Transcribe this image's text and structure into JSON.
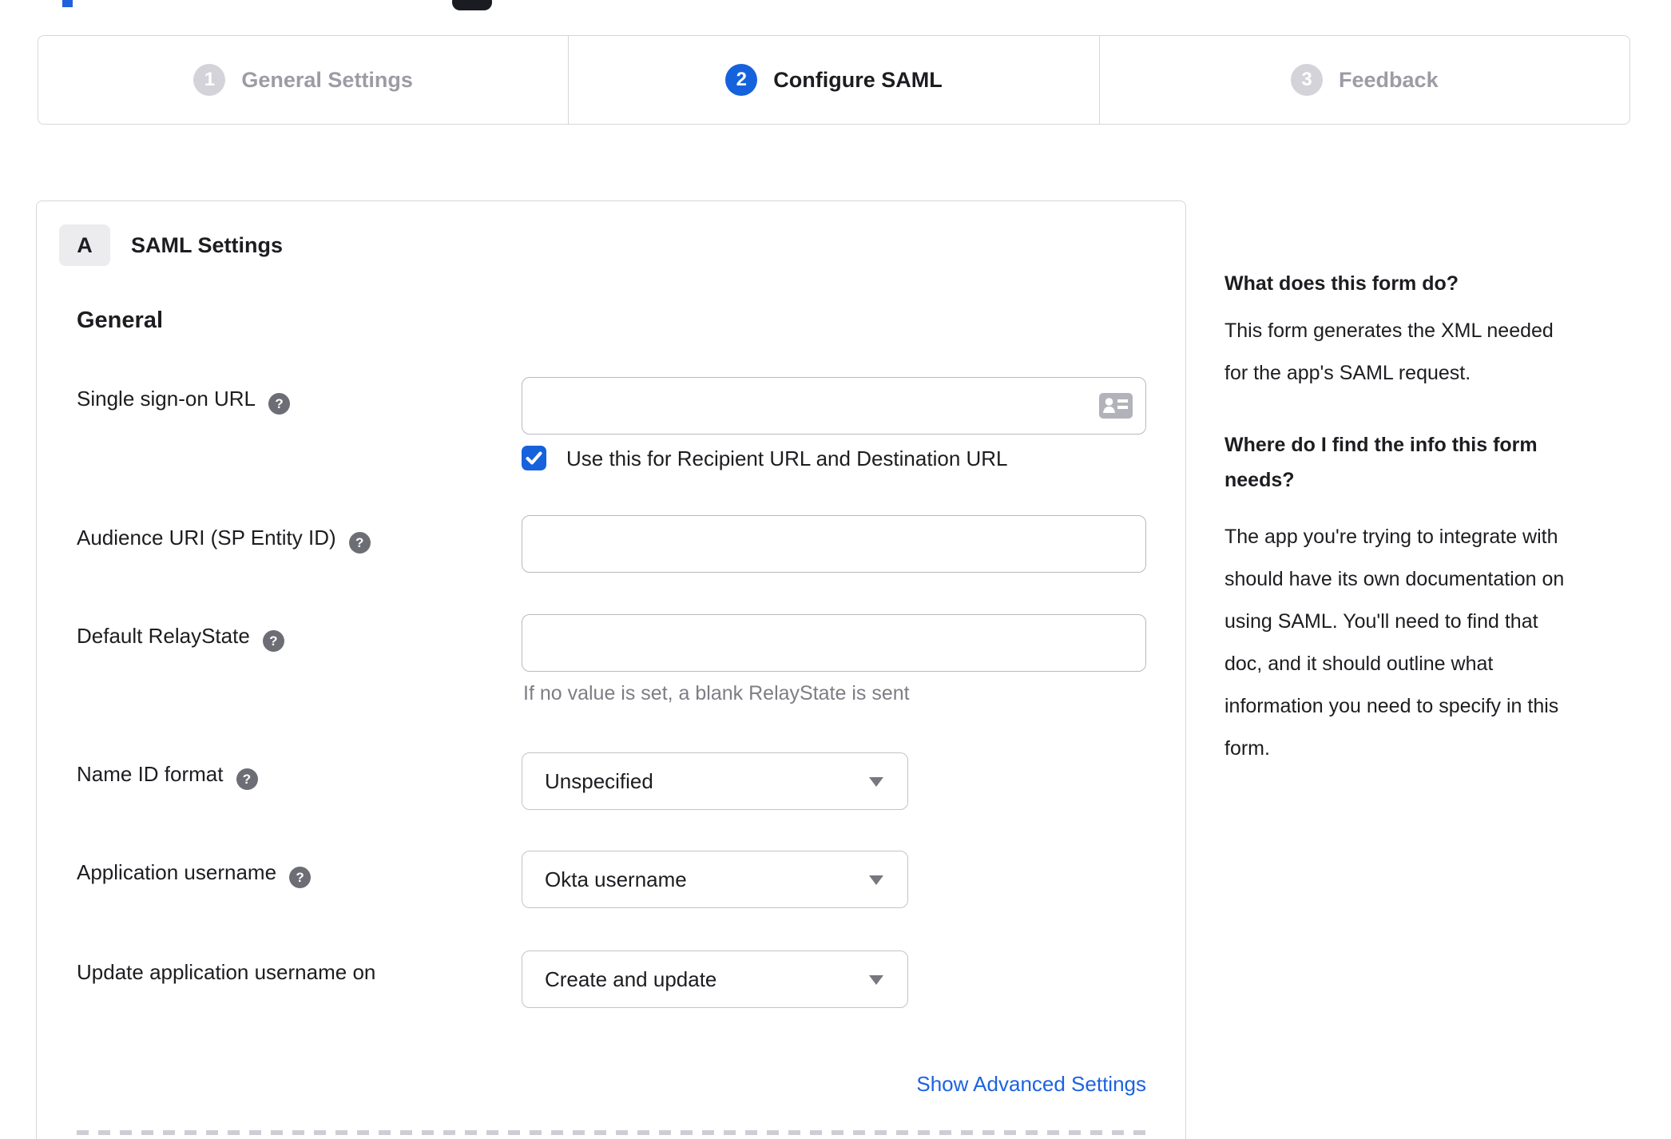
{
  "stepper": {
    "active_index": 1,
    "steps": [
      {
        "number": "1",
        "label": "General Settings"
      },
      {
        "number": "2",
        "label": "Configure SAML"
      },
      {
        "number": "3",
        "label": "Feedback"
      }
    ]
  },
  "panel": {
    "badge": "A",
    "title": "SAML Settings",
    "heading": "General",
    "fields": [
      {
        "label": "Single sign-on URL",
        "type": "text",
        "value": "",
        "has_help": true
      },
      {
        "label": "Audience URI (SP Entity ID)",
        "type": "text",
        "value": "",
        "has_help": true
      },
      {
        "label": "Default RelayState",
        "type": "text",
        "value": "",
        "has_help": true,
        "hint": "If no value is set, a blank RelayState is sent"
      },
      {
        "label": "Name ID format",
        "type": "select",
        "value": "Unspecified",
        "has_help": true
      },
      {
        "label": "Application username",
        "type": "select",
        "value": "Okta username",
        "has_help": true
      },
      {
        "label": "Update application username on",
        "type": "select",
        "value": "Create and update",
        "has_help": false
      }
    ],
    "sso_checkbox": {
      "label": "Use this for Recipient URL and Destination URL",
      "checked": true
    },
    "advanced_link": "Show Advanced Settings"
  },
  "sidebar": {
    "what": {
      "heading": "What does this form do?",
      "lines": [
        "This form generates the XML needed",
        "for the app's SAML request."
      ]
    },
    "where": {
      "heading_lines": [
        "Where do I find the info this form",
        "needs?"
      ],
      "lines": [
        "The app you're trying to integrate with",
        "should have its own documentation on",
        "using SAML. You'll need to find that",
        "doc, and it should outline what",
        "information you need to specify in this",
        "form."
      ]
    }
  },
  "icons": {
    "help": "?"
  },
  "colors": {
    "accent": "#1662dd",
    "text": "#1d1d21",
    "muted": "#7d7d85",
    "border": "#d7d7dc"
  }
}
